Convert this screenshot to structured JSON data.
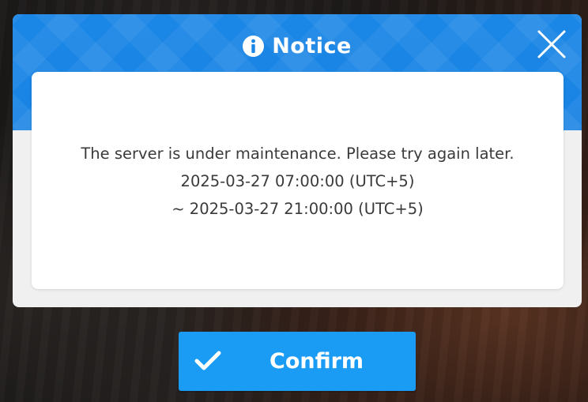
{
  "dialog": {
    "title": "Notice",
    "title_icon": "info-icon",
    "close_icon": "close-icon",
    "message_lines": [
      "The server is under maintenance. Please try again later.",
      "2025-03-27 07:00:00 (UTC+5)",
      "~ 2025-03-27 21:00:00 (UTC+5)"
    ]
  },
  "confirm_button": {
    "label": "Confirm",
    "icon": "checkmark-icon"
  },
  "colors": {
    "header_blue": "#1a86e6",
    "button_blue": "#1a9cf5",
    "panel_white": "#ffffff",
    "dialog_gray": "#f0f0f0",
    "text_dark": "#3a3a3a"
  }
}
